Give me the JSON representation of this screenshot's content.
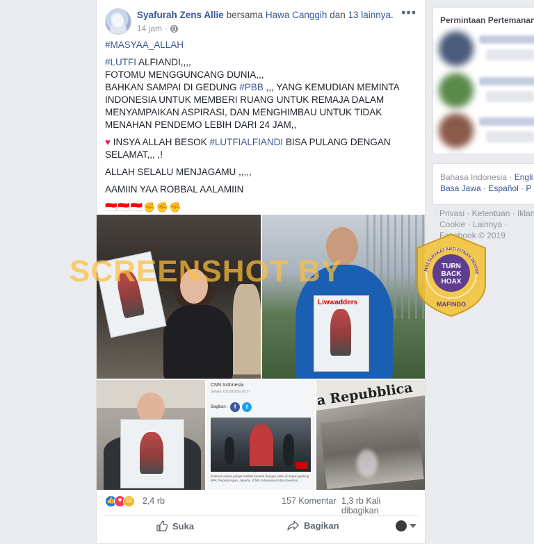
{
  "post": {
    "author": "Syafurah Zens Allie",
    "with_text": "bersama",
    "tagged": "Hawa Canggih",
    "and_text": "dan",
    "others": "13 lainnya",
    "period": ".",
    "time": "14 jam",
    "dot": "·",
    "more": "•••",
    "body": {
      "hashtag1": "#MASYAA_ALLAH",
      "line1_tag": "#LUTFI",
      "line1_text": " ALFIANDI,,,,",
      "line2": "FOTOMU MENGGUNCANG DUNIA,,,",
      "line3_pre": "BAHKAN SAMPAI DI GEDUNG ",
      "line3_tag": "#PBB",
      "line3_post": " ,,, YANG KEMUDIAN MEMINTA INDONESIA UNTUK MEMBERI RUANG UNTUK REMAJA DALAM MENYAMPAIKAN ASPIRASI, DAN MENGHIMBAU UNTUK TIDAK MENAHAN PENDEMO LEBIH DARI 24 JAM,,",
      "heart": "♥",
      "line4_pre": " INSYA ALLAH BESOK ",
      "line4_tag": "#LUTFIALFIANDI",
      "line4_post": " BISA PULANG DENGAN SELAMAT,,, ,!",
      "line5": "ALLAH SELALU MENJAGAMU ,,,,,",
      "line6": "AAMIIN YAA ROBBAL AALAMIIN",
      "emoji": "🇮🇩🇮🇩🇮🇩✊✊✊"
    },
    "photos": {
      "poster_word": "Liwwadders",
      "cnn_source": "CNN Indonesia",
      "cnn_date": "Selasa, 01/10/2019 20:17",
      "cnn_share": "Bagikan :",
      "cnn_caption": "Ilustrasi massa pelajar terlibat bentrok dengan polisi di depan gedung BPK Pejompongan, Jakarta. (CNN Indonesia/Andry Novelino)",
      "newspaper": "a Repubblica"
    },
    "watermark": "SCREENSHOT BY",
    "badge": {
      "ring_text": "MASYARAKAT ANTI FITNAH INDONESIA",
      "line1": "TURN",
      "line2": "BACK",
      "line3": "HOAX",
      "bottom": "MAFINDO"
    },
    "stats": {
      "reactions": "2,4 rb",
      "comments": "157 Komentar",
      "shares": "1,3 rb Kali dibagikan"
    },
    "actions": {
      "like": "Suka",
      "share": "Bagikan"
    }
  },
  "sidebar": {
    "friend_requests_title": "Permintaan Pertemanan",
    "languages_line1": {
      "current": "Bahasa Indonesia",
      "sep": " · ",
      "next": "Engli"
    },
    "languages_line2": {
      "l1": "Basa Jawa",
      "sep": " · ",
      "l2": "Español",
      "sep2": " · ",
      "l3": "P"
    },
    "footer": {
      "line1": "Privasi · Ketentuan · Iklan",
      "line2": "Cookie · Lainnya ·",
      "line3": "Facebook © 2019"
    }
  },
  "colors": {
    "link": "#365899",
    "background": "#e9ebee",
    "watermark": "#ffbe3c",
    "badge": "#f2c230"
  }
}
